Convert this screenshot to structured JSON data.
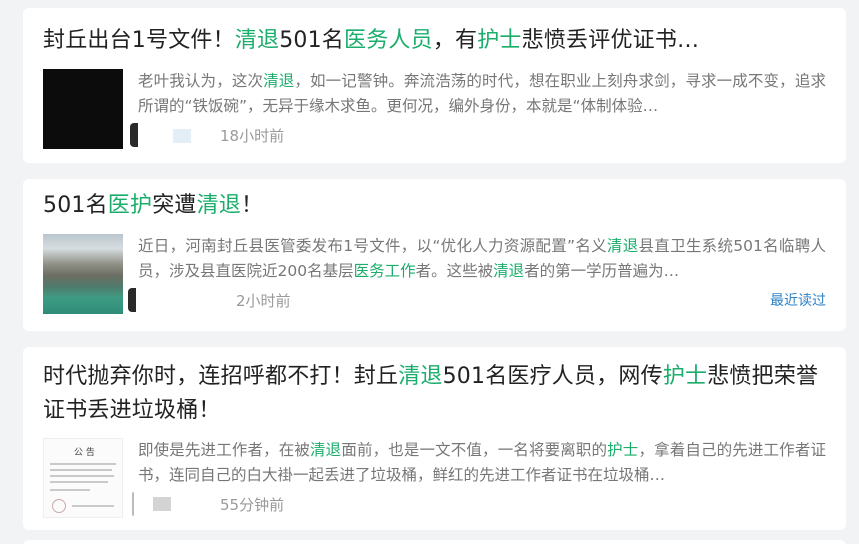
{
  "articles": [
    {
      "title_parts": [
        {
          "text": "封丘出台1号文件！",
          "hl": false
        },
        {
          "text": "清退",
          "hl": true
        },
        {
          "text": "501名",
          "hl": false
        },
        {
          "text": "医务人员",
          "hl": true
        },
        {
          "text": "，有",
          "hl": false
        },
        {
          "text": "护士",
          "hl": true
        },
        {
          "text": "悲愤丢评优证书…",
          "hl": false
        }
      ],
      "desc_parts": [
        {
          "text": "老叶我认为，这次",
          "hl": false
        },
        {
          "text": "清退",
          "hl": true
        },
        {
          "text": "，如一记警钟。奔流浩荡的时代，想在职业上刻舟求剑，寻求一成不变，追求所谓的“铁饭碗”，无异于缘木求鱼。更何况，编外身份，本就是“体制体验…",
          "hl": false
        }
      ],
      "time": "18小时前",
      "thumb": "dark-photo"
    },
    {
      "title_parts": [
        {
          "text": "501名",
          "hl": false
        },
        {
          "text": "医护",
          "hl": true
        },
        {
          "text": "突遭",
          "hl": false
        },
        {
          "text": "清退",
          "hl": true
        },
        {
          "text": "！",
          "hl": false
        }
      ],
      "desc_parts": [
        {
          "text": "近日，河南封丘县医管委发布1号文件，以“优化人力资源配置”名义",
          "hl": false
        },
        {
          "text": "清退",
          "hl": true
        },
        {
          "text": "县直卫生系统501名临聘人员，涉及县直医院近200名基层",
          "hl": false
        },
        {
          "text": "医务工作",
          "hl": true
        },
        {
          "text": "者。这些被",
          "hl": false
        },
        {
          "text": "清退",
          "hl": true
        },
        {
          "text": "者的第一学历普遍为…",
          "hl": false
        }
      ],
      "time": "2小时前",
      "recent": "最近读过",
      "thumb": "landscape-photo"
    },
    {
      "title_parts": [
        {
          "text": "时代抛弃你时，连招呼都不打！封丘",
          "hl": false
        },
        {
          "text": "清退",
          "hl": true
        },
        {
          "text": "501名医疗人员，网传",
          "hl": false
        },
        {
          "text": "护士",
          "hl": true
        },
        {
          "text": "悲愤把荣誉证书丢进垃圾桶！",
          "hl": false
        }
      ],
      "desc_parts": [
        {
          "text": "即使是先进工作者，在被",
          "hl": false
        },
        {
          "text": "清退",
          "hl": true
        },
        {
          "text": "面前，也是一文不值，一名将要离职的",
          "hl": false
        },
        {
          "text": "护士",
          "hl": true
        },
        {
          "text": "，拿着自己的先进工作者证书，连同自己的白大褂一起丢进了垃圾桶，鲜红的先进工作者证书在垃圾桶…",
          "hl": false
        }
      ],
      "time": "55分钟前",
      "thumb": "document-photo",
      "thumb_text": "公 告"
    }
  ],
  "colors": {
    "highlight": "#1aad6b",
    "link": "#2f82c6",
    "meta": "#9a9a9a",
    "background": "#f2f3f5"
  }
}
